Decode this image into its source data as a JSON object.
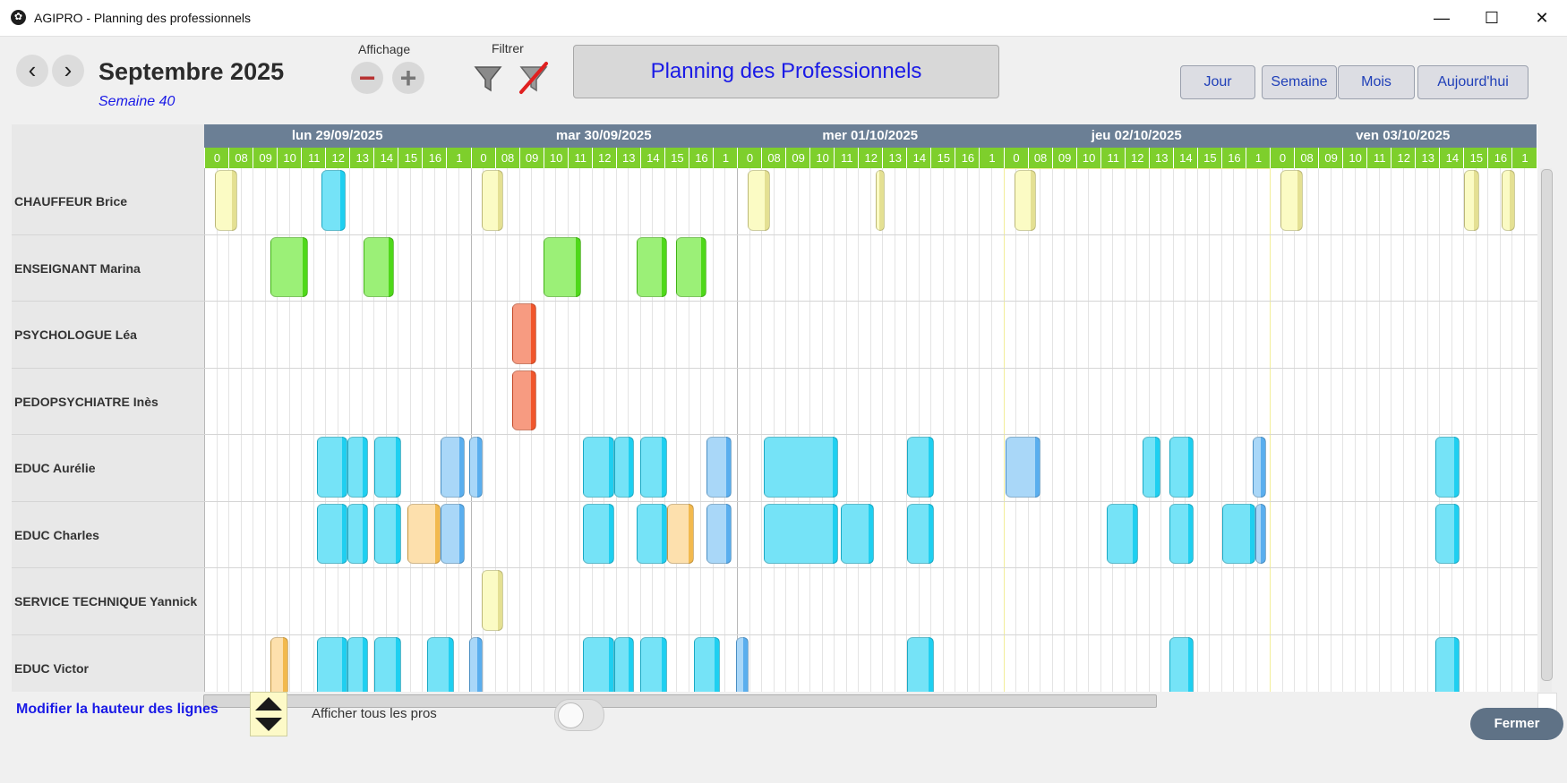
{
  "window": {
    "title": "AGIPRO - Planning des professionnels",
    "controls": {
      "minimize": "—",
      "maximize": "☐",
      "close": "✕"
    }
  },
  "toolbar": {
    "prev": "‹",
    "next": "›",
    "month": "Septembre 2025",
    "week": "Semaine 40",
    "display_label": "Affichage",
    "zoom_out": "−",
    "zoom_in": "+",
    "filter_label": "Filtrer",
    "banner": "Planning des Professionnels",
    "views": {
      "day": "Jour",
      "week": "Semaine",
      "month": "Mois",
      "today": "Aujourd'hui"
    }
  },
  "schedule": {
    "days": [
      "lun 29/09/2025",
      "mar 30/09/2025",
      "mer 01/10/2025",
      "jeu 02/10/2025",
      "ven 03/10/2025"
    ],
    "hours": [
      "0",
      "08",
      "09",
      "10",
      "11",
      "12",
      "13",
      "14",
      "15",
      "16",
      "1"
    ],
    "today_index": 3,
    "professionals": [
      "CHAUFFEUR Brice",
      "ENSEIGNANT  Marina",
      "PSYCHOLOGUE Léa",
      "PEDOPSYCHIATRE Inès",
      "EDUC Aurélie",
      "EDUC Charles",
      "SERVICE TECHNIQUE Yannick",
      "EDUC Victor"
    ],
    "colors": {
      "yellow": "#fbfbc4",
      "cyan": "#75e3f7",
      "green": "#9bf077",
      "salmon": "#f79b81",
      "lightblue": "#a9d7f8",
      "peach": "#fde0ad",
      "stripe_yellow": "#e4e093",
      "stripe_cyan": "#1fcff0",
      "stripe_green": "#4fd81a",
      "stripe_salmon": "#f0562c",
      "stripe_lightblue": "#5aaeee",
      "stripe_peach": "#f2b94e"
    },
    "events": [
      {
        "row": 0,
        "day": 0,
        "start": "07:55",
        "end": "08:45",
        "color": "yellow"
      },
      {
        "row": 0,
        "day": 0,
        "start": "11:55",
        "end": "12:50",
        "color": "cyan"
      },
      {
        "row": 0,
        "day": 1,
        "start": "07:55",
        "end": "08:45",
        "color": "yellow"
      },
      {
        "row": 0,
        "day": 2,
        "start": "07:55",
        "end": "08:45",
        "color": "yellow"
      },
      {
        "row": 0,
        "day": 2,
        "start": "12:45",
        "end": "13:05",
        "color": "yellow"
      },
      {
        "row": 0,
        "day": 3,
        "start": "07:55",
        "end": "08:45",
        "color": "yellow"
      },
      {
        "row": 0,
        "day": 4,
        "start": "07:55",
        "end": "08:45",
        "color": "yellow"
      },
      {
        "row": 0,
        "day": 4,
        "start": "14:50",
        "end": "15:25",
        "color": "yellow"
      },
      {
        "row": 0,
        "day": 4,
        "start": "16:15",
        "end": "16:45",
        "color": "yellow"
      },
      {
        "row": 1,
        "day": 0,
        "start": "10:00",
        "end": "11:25",
        "color": "green"
      },
      {
        "row": 1,
        "day": 0,
        "start": "13:30",
        "end": "14:40",
        "color": "green"
      },
      {
        "row": 1,
        "day": 1,
        "start": "10:15",
        "end": "11:40",
        "color": "green"
      },
      {
        "row": 1,
        "day": 1,
        "start": "13:45",
        "end": "14:55",
        "color": "green"
      },
      {
        "row": 1,
        "day": 1,
        "start": "15:15",
        "end": "16:25",
        "color": "green"
      },
      {
        "row": 2,
        "day": 1,
        "start": "09:05",
        "end": "10:00",
        "color": "salmon"
      },
      {
        "row": 3,
        "day": 1,
        "start": "09:05",
        "end": "10:00",
        "color": "salmon"
      },
      {
        "row": 4,
        "day": 0,
        "start": "11:45",
        "end": "12:55",
        "color": "cyan"
      },
      {
        "row": 4,
        "day": 0,
        "start": "12:55",
        "end": "13:40",
        "color": "cyan"
      },
      {
        "row": 4,
        "day": 0,
        "start": "13:55",
        "end": "14:55",
        "color": "cyan"
      },
      {
        "row": 4,
        "day": 0,
        "start": "16:25",
        "end": "17:20",
        "color": "lightblue"
      },
      {
        "row": 4,
        "day": 0,
        "start": "17:30",
        "end": "18:00",
        "color": "lightblue"
      },
      {
        "row": 4,
        "day": 1,
        "start": "11:45",
        "end": "12:55",
        "color": "cyan"
      },
      {
        "row": 4,
        "day": 1,
        "start": "12:55",
        "end": "13:40",
        "color": "cyan"
      },
      {
        "row": 4,
        "day": 1,
        "start": "13:55",
        "end": "14:55",
        "color": "cyan"
      },
      {
        "row": 4,
        "day": 1,
        "start": "16:25",
        "end": "17:20",
        "color": "lightblue"
      },
      {
        "row": 4,
        "day": 2,
        "start": "08:30",
        "end": "11:20",
        "color": "cyan"
      },
      {
        "row": 4,
        "day": 2,
        "start": "13:55",
        "end": "14:55",
        "color": "cyan"
      },
      {
        "row": 4,
        "day": 3,
        "start": "07:35",
        "end": "08:55",
        "color": "lightblue"
      },
      {
        "row": 4,
        "day": 3,
        "start": "12:45",
        "end": "13:25",
        "color": "cyan"
      },
      {
        "row": 4,
        "day": 3,
        "start": "13:45",
        "end": "14:40",
        "color": "cyan"
      },
      {
        "row": 4,
        "day": 3,
        "start": "16:55",
        "end": "17:25",
        "color": "lightblue"
      },
      {
        "row": 4,
        "day": 4,
        "start": "13:45",
        "end": "14:40",
        "color": "cyan"
      },
      {
        "row": 5,
        "day": 0,
        "start": "11:45",
        "end": "12:55",
        "color": "cyan"
      },
      {
        "row": 5,
        "day": 0,
        "start": "12:55",
        "end": "13:40",
        "color": "cyan"
      },
      {
        "row": 5,
        "day": 0,
        "start": "13:55",
        "end": "14:55",
        "color": "cyan"
      },
      {
        "row": 5,
        "day": 0,
        "start": "15:10",
        "end": "16:25",
        "color": "peach"
      },
      {
        "row": 5,
        "day": 0,
        "start": "16:25",
        "end": "17:20",
        "color": "lightblue"
      },
      {
        "row": 5,
        "day": 1,
        "start": "11:45",
        "end": "12:55",
        "color": "cyan"
      },
      {
        "row": 5,
        "day": 1,
        "start": "13:45",
        "end": "14:55",
        "color": "cyan"
      },
      {
        "row": 5,
        "day": 1,
        "start": "14:55",
        "end": "15:55",
        "color": "peach"
      },
      {
        "row": 5,
        "day": 1,
        "start": "16:25",
        "end": "17:20",
        "color": "lightblue"
      },
      {
        "row": 5,
        "day": 2,
        "start": "08:30",
        "end": "11:20",
        "color": "cyan"
      },
      {
        "row": 5,
        "day": 2,
        "start": "11:25",
        "end": "12:40",
        "color": "cyan"
      },
      {
        "row": 5,
        "day": 2,
        "start": "13:55",
        "end": "14:55",
        "color": "cyan"
      },
      {
        "row": 5,
        "day": 3,
        "start": "11:25",
        "end": "12:35",
        "color": "cyan"
      },
      {
        "row": 5,
        "day": 3,
        "start": "13:45",
        "end": "14:40",
        "color": "cyan"
      },
      {
        "row": 5,
        "day": 3,
        "start": "15:45",
        "end": "17:00",
        "color": "cyan"
      },
      {
        "row": 5,
        "day": 3,
        "start": "17:00",
        "end": "17:25",
        "color": "lightblue"
      },
      {
        "row": 5,
        "day": 4,
        "start": "13:45",
        "end": "14:40",
        "color": "cyan"
      },
      {
        "row": 6,
        "day": 1,
        "start": "07:55",
        "end": "08:45",
        "color": "yellow"
      },
      {
        "row": 7,
        "day": 0,
        "start": "10:00",
        "end": "10:40",
        "color": "peach"
      },
      {
        "row": 7,
        "day": 0,
        "start": "11:45",
        "end": "12:55",
        "color": "cyan"
      },
      {
        "row": 7,
        "day": 0,
        "start": "12:55",
        "end": "13:40",
        "color": "cyan"
      },
      {
        "row": 7,
        "day": 0,
        "start": "13:55",
        "end": "14:55",
        "color": "cyan"
      },
      {
        "row": 7,
        "day": 0,
        "start": "15:55",
        "end": "16:55",
        "color": "cyan"
      },
      {
        "row": 7,
        "day": 0,
        "start": "17:30",
        "end": "18:00",
        "color": "lightblue"
      },
      {
        "row": 7,
        "day": 1,
        "start": "11:45",
        "end": "12:55",
        "color": "cyan"
      },
      {
        "row": 7,
        "day": 1,
        "start": "12:55",
        "end": "13:40",
        "color": "cyan"
      },
      {
        "row": 7,
        "day": 1,
        "start": "13:55",
        "end": "14:55",
        "color": "cyan"
      },
      {
        "row": 7,
        "day": 1,
        "start": "15:55",
        "end": "16:55",
        "color": "cyan"
      },
      {
        "row": 7,
        "day": 1,
        "start": "17:30",
        "end": "18:00",
        "color": "lightblue"
      },
      {
        "row": 7,
        "day": 2,
        "start": "13:55",
        "end": "14:55",
        "color": "cyan"
      },
      {
        "row": 7,
        "day": 3,
        "start": "13:45",
        "end": "14:40",
        "color": "cyan"
      },
      {
        "row": 7,
        "day": 4,
        "start": "13:45",
        "end": "14:40",
        "color": "cyan"
      }
    ]
  },
  "footer": {
    "row_height_label": "Modifier la hauteur des lignes",
    "toggle_label": "Afficher tous les pros",
    "toggle_on": false,
    "close": "Fermer"
  }
}
